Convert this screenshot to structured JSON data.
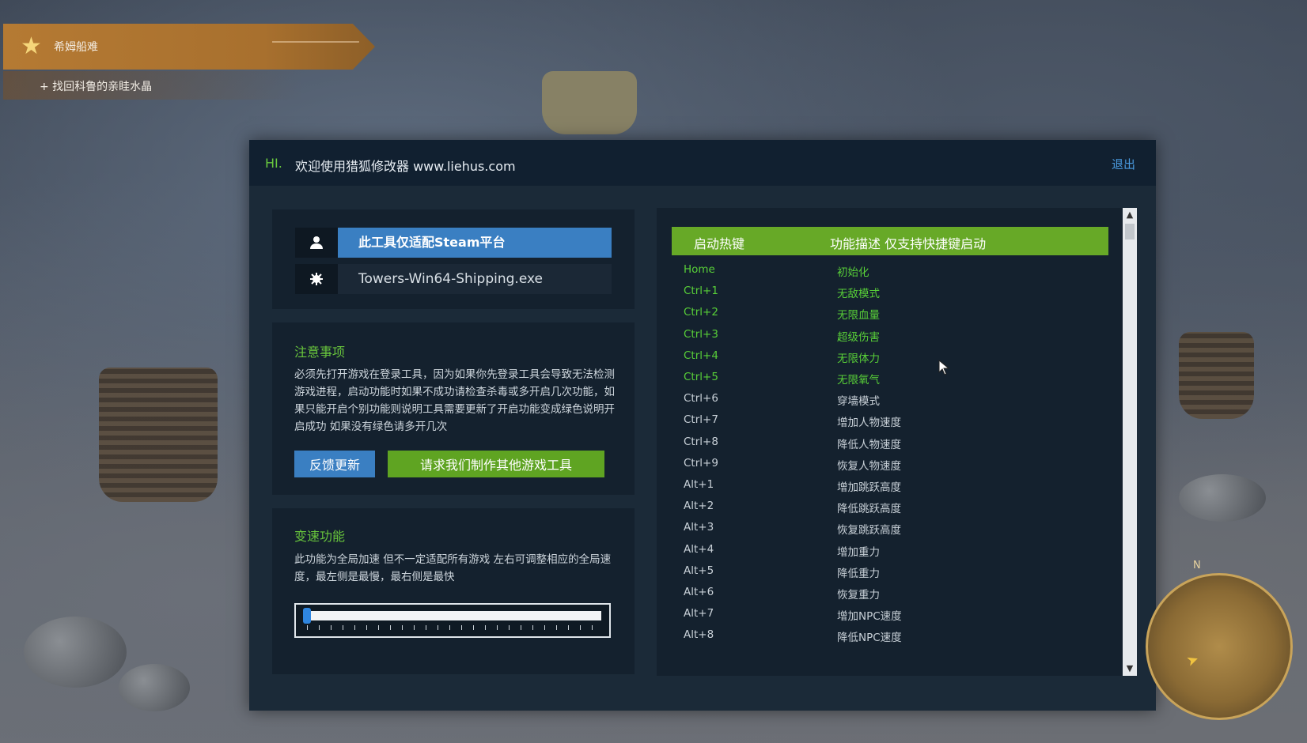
{
  "quest": {
    "title": "希姆船难",
    "objective": "+ 找回科鲁的亲眭水晶"
  },
  "window": {
    "hi": "HI.",
    "welcome": "欢迎使用猎狐修改器 www.liehus.com",
    "exit": "退出"
  },
  "info": {
    "steam_label": "此工具仅适配Steam平台",
    "exe_label": "Towers-Win64-Shipping.exe",
    "user_icon": "user-icon",
    "gear_icon": "gear-icon"
  },
  "notice": {
    "title": "注意事项",
    "text": "必须先打开游戏在登录工具，因为如果你先登录工具会导致无法检测游戏进程，启动功能时如果不成功请检查杀毒或多开启几次功能，如果只能开启个别功能则说明工具需要更新了开启功能变成绿色说明开启成功 如果没有绿色请多开几次",
    "feedback_button": "反馈更新",
    "request_button": "请求我们制作其他游戏工具"
  },
  "speed": {
    "title": "变速功能",
    "text": "此功能为全局加速 但不一定适配所有游戏 左右可调整相应的全局速度，最左侧是最慢，最右侧是最快",
    "slider_value": 0
  },
  "hotkeys": {
    "header_key": "启动热键",
    "header_desc": "功能描述 仅支持快捷键启动",
    "rows": [
      {
        "key": "Home",
        "desc": "初始化",
        "active": true
      },
      {
        "key": "Ctrl+1",
        "desc": "无敌模式",
        "active": true
      },
      {
        "key": "Ctrl+2",
        "desc": "无限血量",
        "active": true
      },
      {
        "key": "Ctrl+3",
        "desc": "超级伤害",
        "active": true
      },
      {
        "key": "Ctrl+4",
        "desc": "无限体力",
        "active": true
      },
      {
        "key": "Ctrl+5",
        "desc": "无限氧气",
        "active": true
      },
      {
        "key": "Ctrl+6",
        "desc": "穿墙模式",
        "active": false
      },
      {
        "key": "Ctrl+7",
        "desc": "增加人物速度",
        "active": false
      },
      {
        "key": "Ctrl+8",
        "desc": "降低人物速度",
        "active": false
      },
      {
        "key": "Ctrl+9",
        "desc": "恢复人物速度",
        "active": false
      },
      {
        "key": "Alt+1",
        "desc": "增加跳跃高度",
        "active": false
      },
      {
        "key": "Alt+2",
        "desc": "降低跳跃高度",
        "active": false
      },
      {
        "key": "Alt+3",
        "desc": "恢复跳跃高度",
        "active": false
      },
      {
        "key": "Alt+4",
        "desc": "增加重力",
        "active": false
      },
      {
        "key": "Alt+5",
        "desc": "降低重力",
        "active": false
      },
      {
        "key": "Alt+6",
        "desc": "恢复重力",
        "active": false
      },
      {
        "key": "Alt+7",
        "desc": "增加NPC速度",
        "active": false
      },
      {
        "key": "Alt+8",
        "desc": "降低NPC速度",
        "active": false
      }
    ]
  },
  "minimap": {
    "north_label": "N"
  },
  "colors": {
    "accent_green": "#67a927",
    "accent_blue": "#3a7fc2",
    "active_text": "#58cf38"
  }
}
